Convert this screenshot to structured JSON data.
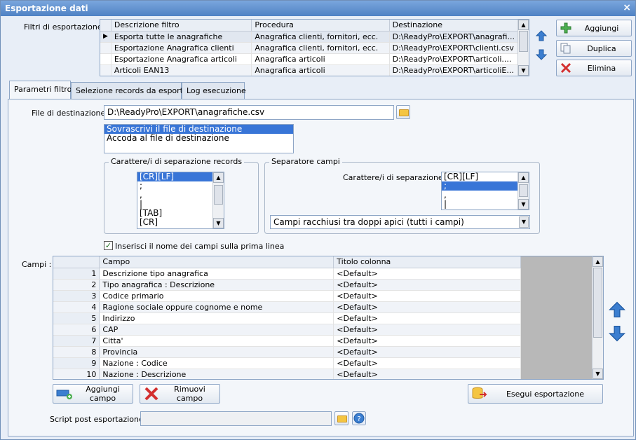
{
  "window": {
    "title": "Esportazione dati",
    "close": "×"
  },
  "filters": {
    "label": "Filtri di esportazione :",
    "columns": [
      "Descrizione filtro",
      "Procedura",
      "Destinazione"
    ],
    "rows": [
      [
        "Esporta tutte le anagrafiche",
        "Anagrafica clienti, fornitori, ecc.",
        "D:\\ReadyPro\\EXPORT\\anagrafi..."
      ],
      [
        "Esportazione Anagrafica clienti",
        "Anagrafica clienti, fornitori, ecc.",
        "D:\\ReadyPro\\EXPORT\\clienti.csv"
      ],
      [
        "Esportazione Anagrafica articoli",
        "Anagrafica articoli",
        "D:\\ReadyPro\\EXPORT\\articoli...."
      ],
      [
        "Articoli EAN13",
        "Anagrafica articoli",
        "D:\\ReadyPro\\EXPORT\\articoliE..."
      ]
    ],
    "selected_marker": "▶"
  },
  "buttons": {
    "add": "Aggiungi",
    "duplicate": "Duplica",
    "delete": "Elimina"
  },
  "tabs": [
    "Parametri filtro",
    "Selezione records da esportare",
    "Log esecuzione"
  ],
  "dest": {
    "label": "File di destinazione :",
    "value": "D:\\ReadyPro\\EXPORT\\anagrafiche.csv",
    "options": [
      "Sovrascrivi il file di destinazione",
      "Accoda al file di destinazione"
    ]
  },
  "record_sep": {
    "title": "Carattere/i di separazione records",
    "items": [
      "[CR][LF]",
      ";",
      ",",
      "|",
      "[TAB]",
      "[CR]"
    ]
  },
  "field_sep": {
    "title": "Separatore campi",
    "label": "Carattere/i di separazione :",
    "items": [
      "[CR][LF]",
      ";",
      ",",
      "|"
    ],
    "quote_option": "Campi racchiusi tra doppi apici (tutti i campi)"
  },
  "header_check": {
    "label": "Inserisci il nome dei campi sulla prima linea",
    "mark": "✓"
  },
  "fields": {
    "label": "Campi :",
    "columns": [
      "Campo",
      "Titolo colonna"
    ],
    "rows": [
      [
        "1",
        "Descrizione tipo anagrafica",
        "<Default>"
      ],
      [
        "2",
        "Tipo anagrafica : Descrizione",
        "<Default>"
      ],
      [
        "3",
        "Codice primario",
        "<Default>"
      ],
      [
        "4",
        "Ragione sociale oppure cognome e nome",
        "<Default>"
      ],
      [
        "5",
        "Indirizzo",
        "<Default>"
      ],
      [
        "6",
        "CAP",
        "<Default>"
      ],
      [
        "7",
        "Citta'",
        "<Default>"
      ],
      [
        "8",
        "Provincia",
        "<Default>"
      ],
      [
        "9",
        "Nazione : Codice",
        "<Default>"
      ],
      [
        "10",
        "Nazione : Descrizione",
        "<Default>"
      ]
    ]
  },
  "bottom": {
    "add_field": "Aggiungi campo",
    "remove_field": "Rimuovi campo",
    "run": "Esegui esportazione",
    "script_label": "Script post esportazione :"
  }
}
